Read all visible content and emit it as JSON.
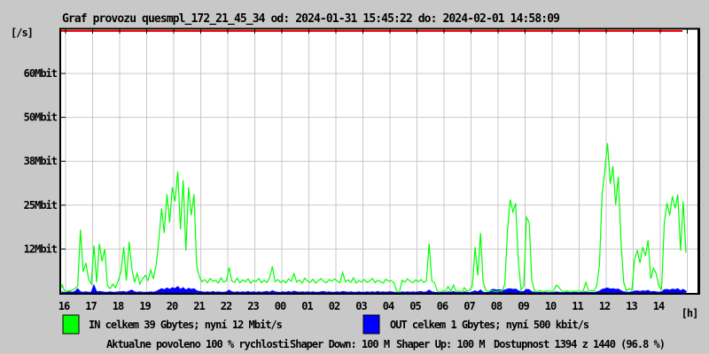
{
  "title": "Graf provozu quesmpl_172_21_45_34 od: 2024-01-31 15:45:22 do: 2024-02-01 14:58:09",
  "y_axis": {
    "unit_label": "[/s]"
  },
  "x_axis": {
    "unit_label": "[h]"
  },
  "legend": [
    {
      "name": "in",
      "swatch_color": "#00ff00",
      "label": "IN celkem 39 Gbytes; nyní 12 Mbit/s"
    },
    {
      "name": "out",
      "swatch_color": "#0000ff",
      "label": "OUT celkem 1 Gbytes; nyní 500 kbit/s"
    }
  ],
  "status_bar": {
    "allowed": {
      "text": "Aktualne povoleno 100 % rychlosti",
      "color": "#ff0000"
    },
    "shaper_down": {
      "text": "Shaper Down: 100 M",
      "color": "#000000"
    },
    "shaper_up": {
      "text": "Shaper Up: 100 M",
      "color": "#a000a0"
    },
    "availability": {
      "text": "Dostupnost 1394 z 1440 (96.8 %)",
      "color": "#000000"
    }
  },
  "colors": {
    "background": "#c8c8c8",
    "plot_background": "#ffffff",
    "grid": "#c8c8c8",
    "frame": "#000000",
    "limit_line": "#ff0000",
    "in_series": "#00ff00",
    "out_series": "#0000ff"
  },
  "chart_data": {
    "type": "line",
    "title": "Graf provozu quesmpl_172_21_45_34",
    "time_from": "2024-01-31 15:45:22",
    "time_to": "2024-02-01 14:58:09",
    "y_unit": "Mbit/s",
    "ylim": [
      0,
      75
    ],
    "grid": true,
    "y_tick_labels": [
      "60Mbit",
      "50Mbit",
      "38Mbit",
      "25Mbit",
      "12Mbit"
    ],
    "y_tick_values_mbit": [
      60,
      50,
      38,
      25,
      12
    ],
    "x_tick_labels": [
      "16",
      "17",
      "18",
      "19",
      "20",
      "21",
      "22",
      "23",
      "00",
      "01",
      "02",
      "03",
      "04",
      "05",
      "06",
      "07",
      "08",
      "09",
      "10",
      "11",
      "12",
      "13",
      "14"
    ],
    "x_start_hour": 15.75,
    "x_step_hours": 0.1,
    "limit_line": {
      "color": "#ff0000",
      "meaning": "Aktualne povoleno 100 % rychlosti"
    },
    "series": [
      {
        "name": "IN",
        "display": "line",
        "color": "#00ff00",
        "total": "39 Gbytes",
        "current": "12 Mbit/s",
        "values": [
          1.5,
          2.5,
          0.6,
          0.5,
          0.6,
          0.8,
          1.2,
          2.0,
          18.0,
          6.0,
          8.5,
          4.0,
          2.5,
          13.5,
          3.0,
          14.0,
          9.0,
          12.5,
          2.0,
          1.2,
          2.5,
          1.5,
          3.5,
          6.0,
          13.0,
          3.5,
          14.5,
          7.0,
          3.0,
          5.5,
          2.5,
          4.0,
          5.0,
          3.5,
          6.5,
          4.0,
          8.0,
          15.0,
          24.0,
          17.0,
          28.0,
          20.0,
          30.0,
          26.0,
          34.5,
          18.0,
          32.0,
          12.0,
          30.0,
          22.0,
          28.0,
          8.0,
          4.5,
          3.2,
          3.8,
          2.9,
          4.1,
          3.3,
          3.6,
          2.8,
          4.3,
          3.1,
          3.5,
          7.2,
          3.4,
          3.0,
          4.2,
          2.9,
          3.7,
          3.2,
          4.0,
          2.8,
          3.5,
          3.3,
          4.1,
          2.9,
          3.6,
          3.0,
          4.4,
          7.5,
          3.2,
          3.8,
          3.0,
          3.5,
          2.9,
          4.0,
          3.3,
          5.5,
          3.1,
          3.7,
          2.8,
          4.2,
          3.4,
          3.0,
          3.9,
          2.8,
          3.5,
          4.1,
          3.2,
          2.9,
          3.8,
          3.3,
          4.0,
          3.4,
          2.9,
          5.8,
          3.2,
          3.7,
          3.0,
          4.3,
          2.8,
          3.5,
          3.1,
          3.8,
          3.0,
          3.4,
          4.1,
          2.9,
          3.6,
          3.2,
          2.8,
          3.9,
          3.3,
          3.5,
          2.9,
          0.4,
          0.3,
          3.6,
          3.1,
          4.0,
          3.3,
          2.9,
          3.7,
          3.2,
          3.8,
          3.0,
          3.5,
          14.0,
          3.4,
          2.9,
          0.5,
          0.3,
          0.6,
          0.4,
          1.8,
          0.5,
          2.2,
          0.4,
          0.6,
          0.3,
          1.5,
          0.5,
          0.8,
          2.0,
          13.0,
          5.0,
          17.0,
          3.0,
          0.6,
          0.4,
          0.7,
          0.5,
          0.4,
          0.6,
          0.5,
          2.5,
          18.0,
          26.5,
          23.0,
          25.5,
          9.0,
          0.8,
          2.0,
          21.5,
          20.0,
          3.5,
          0.6,
          0.4,
          0.7,
          0.3,
          0.5,
          0.6,
          0.4,
          0.5,
          2.2,
          1.6,
          0.5,
          0.4,
          0.6,
          0.3,
          0.5,
          0.4,
          0.6,
          0.4,
          0.6,
          3.0,
          0.5,
          0.7,
          0.5,
          2.0,
          8.0,
          28.0,
          35.0,
          42.5,
          31.0,
          36.0,
          25.0,
          33.0,
          14.0,
          3.0,
          0.6,
          1.2,
          0.8,
          9.5,
          12.0,
          8.5,
          13.0,
          10.5,
          15.0,
          4.0,
          7.0,
          5.5,
          2.0,
          1.0,
          20.0,
          25.5,
          22.0,
          27.5,
          24.0,
          28.0,
          12.0,
          26.0,
          11.5
        ]
      },
      {
        "name": "OUT",
        "display": "area",
        "color": "#0000ff",
        "total": "1 Gbytes",
        "current": "500 kbit/s",
        "values": [
          0.2,
          0.3,
          0.1,
          0.2,
          0.3,
          0.2,
          0.4,
          1.2,
          0.3,
          0.2,
          0.3,
          0.2,
          0.2,
          2.2,
          0.3,
          0.4,
          0.3,
          0.2,
          0.2,
          0.3,
          0.2,
          0.2,
          0.3,
          0.3,
          0.4,
          0.2,
          0.5,
          0.8,
          0.3,
          0.2,
          0.3,
          0.2,
          0.2,
          0.2,
          0.3,
          0.2,
          0.4,
          0.8,
          1.2,
          0.9,
          1.4,
          1.0,
          1.5,
          1.2,
          1.8,
          1.0,
          1.5,
          0.8,
          1.3,
          1.0,
          1.2,
          0.6,
          0.4,
          0.3,
          0.2,
          0.3,
          0.2,
          0.4,
          0.2,
          0.3,
          0.2,
          0.2,
          0.3,
          0.8,
          0.3,
          0.2,
          0.3,
          0.2,
          0.3,
          0.2,
          0.4,
          0.2,
          0.3,
          0.2,
          0.3,
          0.2,
          0.3,
          0.4,
          0.2,
          0.6,
          0.3,
          0.2,
          0.2,
          0.3,
          0.2,
          0.4,
          0.2,
          0.5,
          0.3,
          0.2,
          0.3,
          0.2,
          0.3,
          0.2,
          0.3,
          0.2,
          0.2,
          0.3,
          0.4,
          0.2,
          0.3,
          0.2,
          0.2,
          0.3,
          0.2,
          0.4,
          0.3,
          0.2,
          0.3,
          0.2,
          0.2,
          0.3,
          0.2,
          0.2,
          0.3,
          0.2,
          0.3,
          0.2,
          0.4,
          0.2,
          0.3,
          0.2,
          0.3,
          0.3,
          0.2,
          0.1,
          0.1,
          0.3,
          0.2,
          0.3,
          0.2,
          0.3,
          0.2,
          0.3,
          0.4,
          0.2,
          0.3,
          0.8,
          0.3,
          0.2,
          0.1,
          0.1,
          0.2,
          0.1,
          0.3,
          0.2,
          0.4,
          0.1,
          0.2,
          0.1,
          0.3,
          0.2,
          0.1,
          0.3,
          0.6,
          0.3,
          0.8,
          0.2,
          0.1,
          0.2,
          0.9,
          1.0,
          0.8,
          0.9,
          0.7,
          0.8,
          1.1,
          1.2,
          1.0,
          1.1,
          0.6,
          0.3,
          0.4,
          1.0,
          0.9,
          0.3,
          0.2,
          0.1,
          0.2,
          0.1,
          0.2,
          0.1,
          0.1,
          0.1,
          0.3,
          0.2,
          0.1,
          0.1,
          0.2,
          0.1,
          0.1,
          0.2,
          0.1,
          0.1,
          0.2,
          0.3,
          0.1,
          0.2,
          0.1,
          0.3,
          0.5,
          1.0,
          1.2,
          1.4,
          1.1,
          1.2,
          1.0,
          1.1,
          0.6,
          0.3,
          0.2,
          0.2,
          0.3,
          0.5,
          0.6,
          0.4,
          0.6,
          0.5,
          0.7,
          0.3,
          0.4,
          0.3,
          0.2,
          0.3,
          0.9,
          1.0,
          0.8,
          1.1,
          0.9,
          1.2,
          0.6,
          1.0,
          0.5
        ]
      }
    ]
  }
}
